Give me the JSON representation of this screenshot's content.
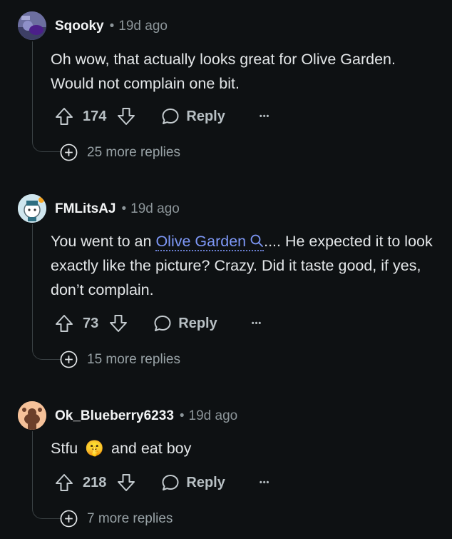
{
  "comments": [
    {
      "username": "Sqooky",
      "time": "19d ago",
      "body": "Oh wow, that actually looks great for Olive Garden. Would not complain one bit.",
      "votes": "174",
      "reply_label": "Reply",
      "more_replies": "25 more replies",
      "avatar_icon": "avatar-sqooky"
    },
    {
      "username": "FMLitsAJ",
      "time": "19d ago",
      "body_pre": "You went to an ",
      "body_link": "Olive Garden",
      "body_post": ".... He expected it to look exactly like the picture? Crazy. Did it taste good, if yes, don’t complain.",
      "votes": "73",
      "reply_label": "Reply",
      "more_replies": "15 more replies",
      "avatar_icon": "avatar-fmlitsaj"
    },
    {
      "username": "Ok_Blueberry6233",
      "time": "19d ago",
      "body_pre": "Stfu",
      "body_emoji": "🤫",
      "body_post": "and eat boy",
      "votes": "218",
      "reply_label": "Reply",
      "more_replies": "7 more replies",
      "avatar_icon": "avatar-snoo-orange"
    }
  ],
  "meta_separator": "•",
  "overflow_icon": "•••",
  "colors": {
    "background": "#0e1113",
    "link": "#7d97f5",
    "meta": "#8c9599"
  }
}
